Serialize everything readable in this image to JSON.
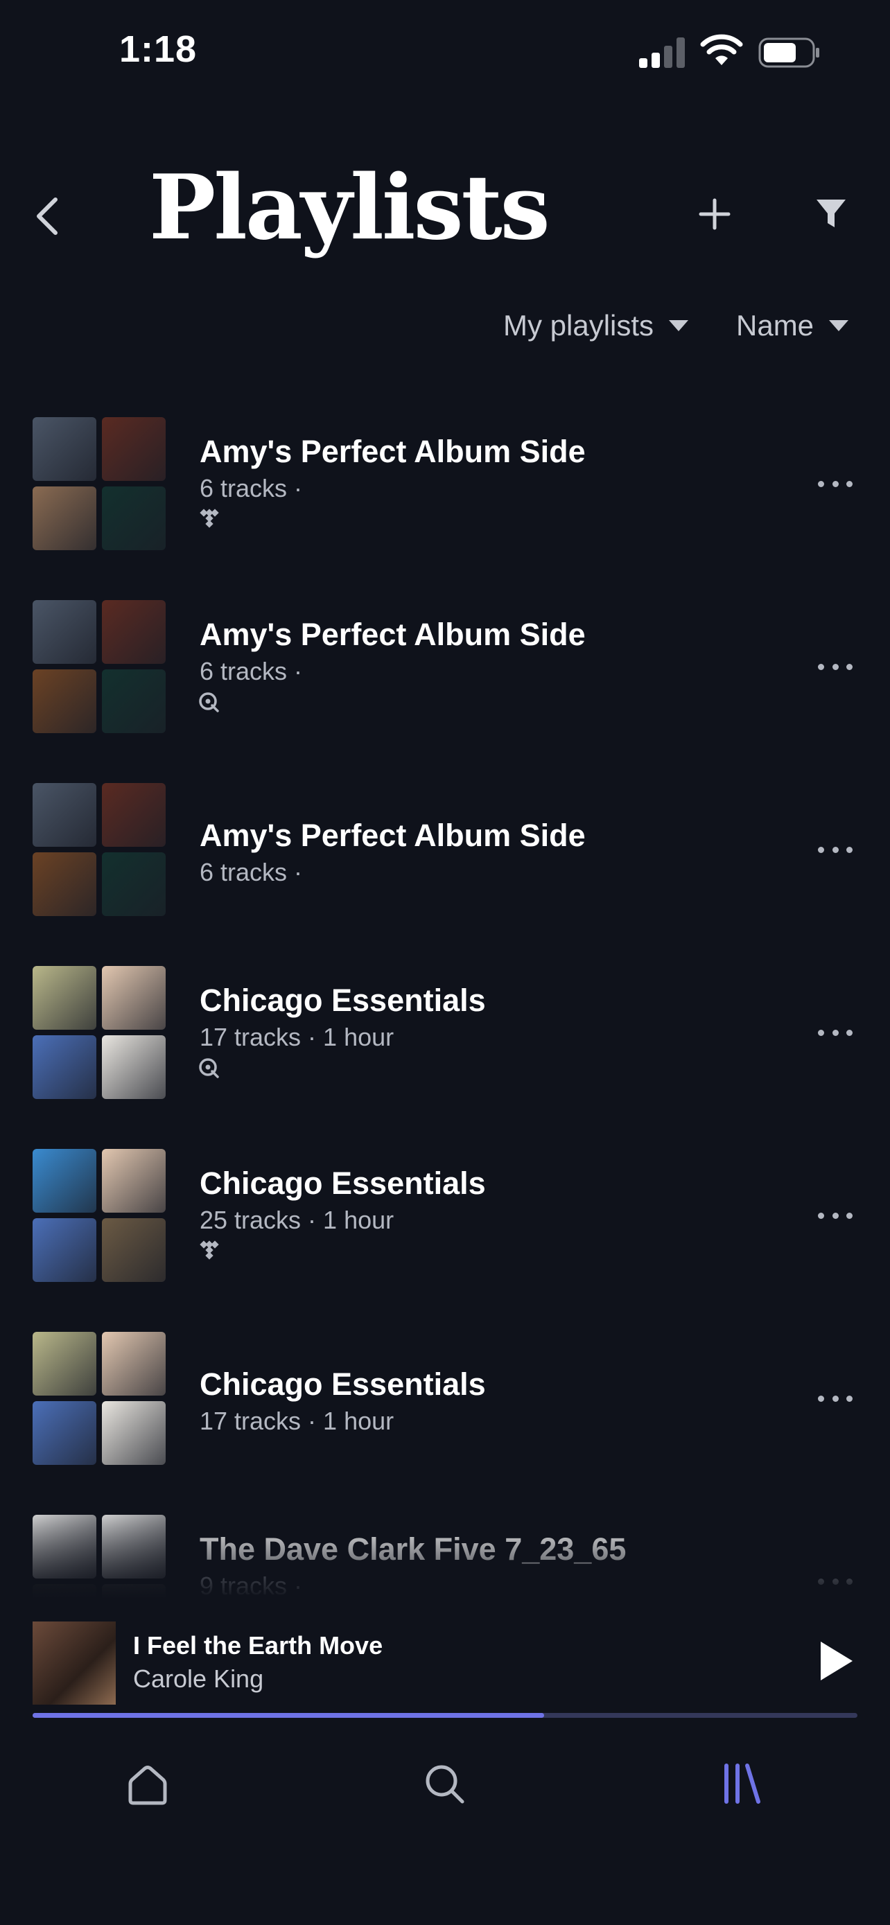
{
  "status_bar": {
    "time": "1:18"
  },
  "header": {
    "title": "Playlists"
  },
  "filters": {
    "owner": "My playlists",
    "sort": "Name"
  },
  "playlists": [
    {
      "name": "Amy's Perfect Album Side",
      "meta": "6 tracks ·",
      "source": "tidal-icon",
      "covers": [
        "#4a5566",
        "#5a2a22",
        "#8a6b52",
        "#13302e"
      ]
    },
    {
      "name": "Amy's Perfect Album Side",
      "meta": "6 tracks ·",
      "source": "qobuz-icon",
      "covers": [
        "#4a5566",
        "#5a2a22",
        "#6b4225",
        "#13302e"
      ]
    },
    {
      "name": "Amy's Perfect Album Side",
      "meta": "6 tracks ·",
      "source": "",
      "covers": [
        "#4a5566",
        "#5a2a22",
        "#6b4225",
        "#13302e"
      ]
    },
    {
      "name": "Chicago Essentials",
      "meta": "17 tracks · 1 hour",
      "source": "qobuz-icon",
      "covers": [
        "#b9b78a",
        "#e2c7b0",
        "#4b6fb8",
        "#e9e6e0"
      ]
    },
    {
      "name": "Chicago Essentials",
      "meta": "25 tracks · 1 hour",
      "source": "tidal-icon",
      "covers": [
        "#3a8bd0",
        "#e2c7b0",
        "#4b6fb8",
        "#6b5a44"
      ]
    },
    {
      "name": "Chicago Essentials",
      "meta": "17 tracks · 1 hour",
      "source": "",
      "covers": [
        "#b9b78a",
        "#e2c7b0",
        "#4b6fb8",
        "#e9e6e0"
      ]
    },
    {
      "name": "The Dave Clark Five 7_23_65",
      "meta": "9 tracks ·",
      "source": "tidal-icon",
      "covers": [
        "#d9d9d9",
        "#d9d9d9",
        "#2a2a2a",
        "#3a3a3a"
      ]
    }
  ],
  "now_playing": {
    "song": "I Feel the Earth Move",
    "artist": "Carole King",
    "progress": 0.62
  },
  "colors": {
    "accent": "#6f73e6",
    "background": "#0f121b"
  }
}
